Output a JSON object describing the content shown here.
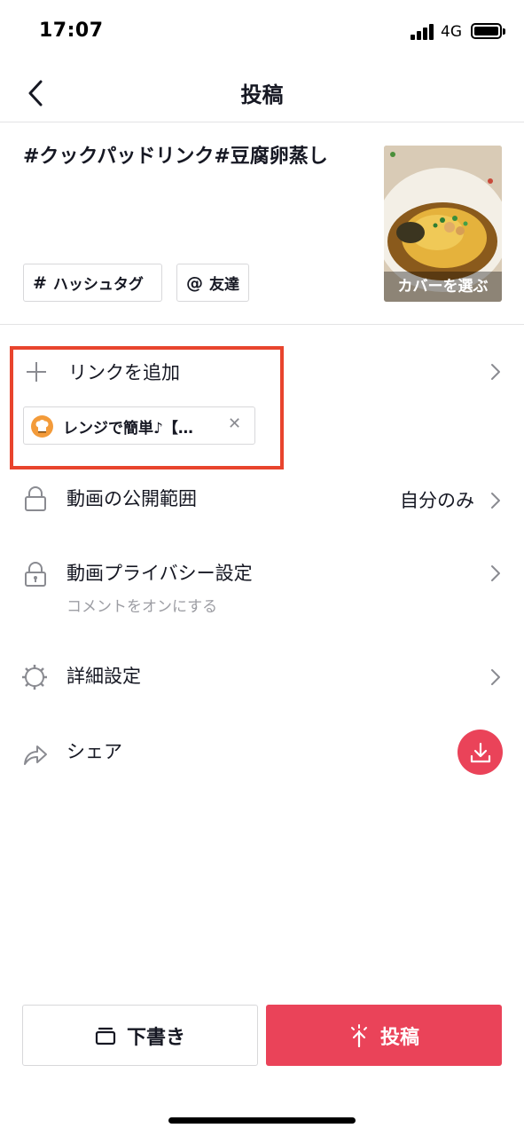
{
  "status_bar": {
    "time": "17:07",
    "network": "4G"
  },
  "header": {
    "title": "投稿"
  },
  "post": {
    "caption": "#クックパッドリンク#豆腐卵蒸し",
    "hashtag_button": "ハッシュタグ",
    "mention_button": "友達",
    "cover_label": "カバーを選ぶ"
  },
  "link": {
    "add_label": "リンクを追加",
    "attached_title": "レンジで簡単♪【…"
  },
  "settings": [
    {
      "label": "動画の公開範囲",
      "value": "自分のみ",
      "icon": "lock-icon"
    },
    {
      "label": "動画プライバシー設定",
      "sub": "コメントをオンにする",
      "icon": "privacy-lock-icon"
    },
    {
      "label": "詳細設定",
      "icon": "gear-icon"
    },
    {
      "label": "シェア",
      "icon": "share-icon"
    }
  ],
  "footer": {
    "draft_label": "下書き",
    "post_label": "投稿"
  },
  "colors": {
    "accent": "#ea4359",
    "highlight_frame": "#e8442d"
  }
}
